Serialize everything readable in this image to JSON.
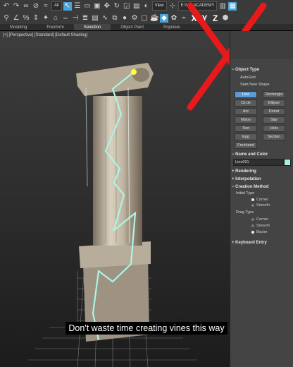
{
  "toolbar": {
    "selection_filter": "All",
    "view_dropdown": "View",
    "workspace_dropdown": "E:\\VIZ ACADEMY",
    "letters": [
      "X",
      "Y",
      "Z"
    ]
  },
  "ribbon_tabs": [
    "Modeling",
    "Freeform",
    "Selection",
    "Object Paint",
    "Populate"
  ],
  "viewport": {
    "label": "[+] [Perspective] [Standard] [Default Shading]"
  },
  "subtitle": "Don't waste time creating vines this way",
  "command_panel": {
    "object_type": {
      "header": "Object Type",
      "autogrid": "AutoGrid",
      "start_new_shape": "Start New Shape",
      "buttons": [
        "Line",
        "Rectangle",
        "Circle",
        "Ellipse",
        "Arc",
        "Donut",
        "NGon",
        "Star",
        "Text",
        "Helix",
        "Egg",
        "Section",
        "Freehand"
      ]
    },
    "name_and_color": {
      "header": "Name and Color",
      "name": "Line001",
      "color": "#a8f0e0"
    },
    "rendering": "Rendering",
    "interpolation": "Interpolation",
    "creation_method": {
      "header": "Creation Method",
      "initial_type_label": "Initial Type",
      "initial_options": [
        "Corner",
        "Smooth"
      ],
      "drag_type_label": "Drag Type",
      "drag_options": [
        "Corner",
        "Smooth",
        "Bezier"
      ]
    },
    "keyboard_entry": "Keyboard Entry"
  }
}
